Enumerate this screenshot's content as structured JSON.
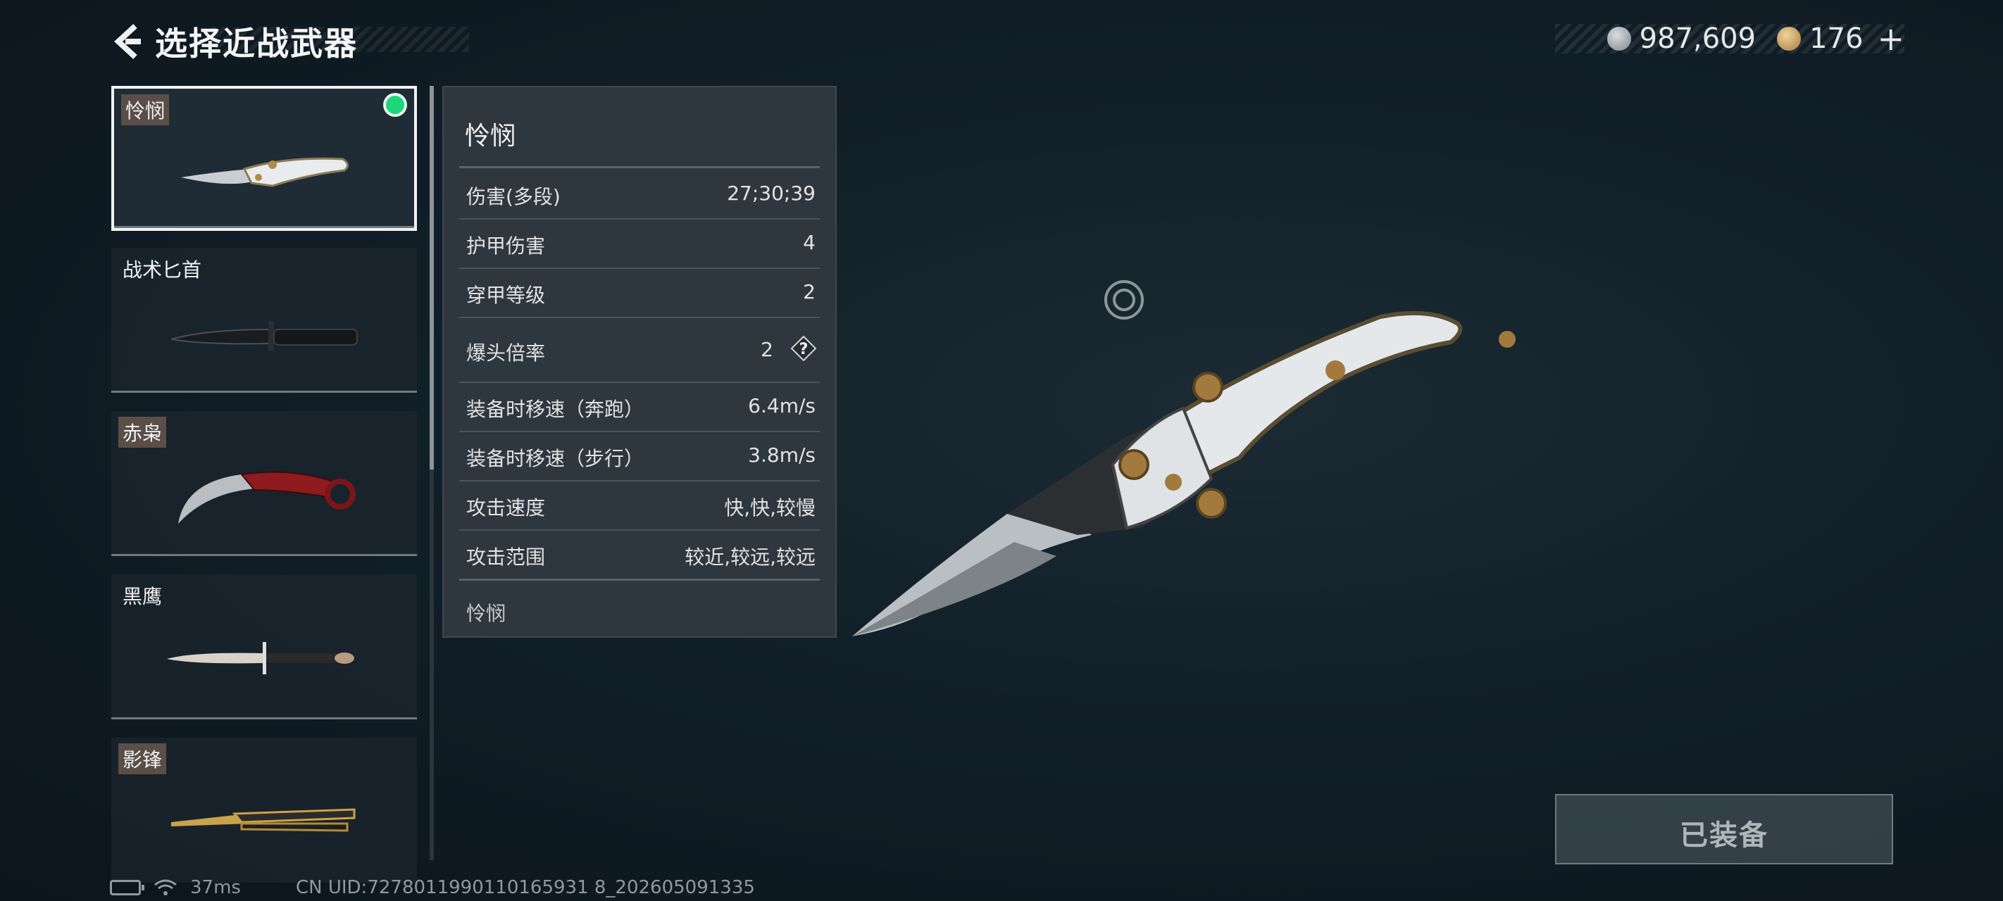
{
  "header": {
    "title": "选择近战武器",
    "back_icon": "back-arrow-icon"
  },
  "currency": [
    {
      "icon": "silver-coin-icon",
      "value": "987,609"
    },
    {
      "icon": "gold-coin-icon",
      "value": "176"
    }
  ],
  "currency_add": "+",
  "weapons": [
    {
      "name": "怜悯",
      "tagged": true,
      "selected": true,
      "equipped": true
    },
    {
      "name": "战术匕首",
      "tagged": false,
      "selected": false,
      "equipped": false
    },
    {
      "name": "赤枭",
      "tagged": true,
      "selected": false,
      "equipped": false
    },
    {
      "name": "黑鹰",
      "tagged": false,
      "selected": false,
      "equipped": false
    },
    {
      "name": "影锋",
      "tagged": true,
      "selected": false,
      "equipped": false
    }
  ],
  "stats": {
    "title": "怜悯",
    "rows": [
      {
        "label": "伤害(多段)",
        "value": "27;30;39"
      },
      {
        "label": "护甲伤害",
        "value": "4"
      },
      {
        "label": "穿甲等级",
        "value": "2"
      },
      {
        "label": "爆头倍率",
        "value": "2"
      },
      {
        "label": "装备时移速（奔跑）",
        "value": "6.4m/s"
      },
      {
        "label": "装备时移速（步行）",
        "value": "3.8m/s"
      },
      {
        "label": "攻击速度",
        "value": "快,快,较慢"
      },
      {
        "label": "攻击范围",
        "value": "较近,较远,较远"
      }
    ],
    "description": "怜悯",
    "help_glyph": "?"
  },
  "equip_button": {
    "label": "已装备"
  },
  "status": {
    "ping": "37ms",
    "uid": "CN UID:7278011990110165931 8_202605091335"
  },
  "colors": {
    "equipped_dot": "#1bd67b",
    "background": "#12202a",
    "tag_bg": "#5a4e47"
  }
}
